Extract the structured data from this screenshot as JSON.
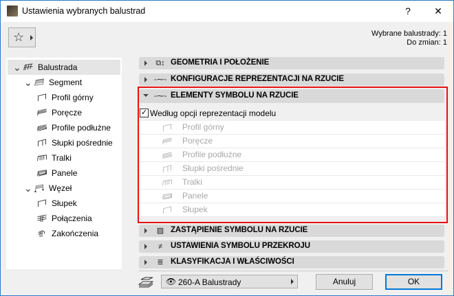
{
  "window": {
    "title": "Ustawienia wybranych balustrad",
    "help_label": "?",
    "close_label": "✕"
  },
  "counts": {
    "selected": "Wybrane balustrady: 1",
    "to_change": "Do zmian: 1"
  },
  "tree": [
    {
      "label": "Balustrada",
      "level": 0,
      "icon": "railing-icon",
      "expanded": true,
      "selected": true
    },
    {
      "label": "Segment",
      "level": 1,
      "icon": "segment-icon",
      "expanded": true
    },
    {
      "label": "Profil górny",
      "level": 2,
      "icon": "top-rail-icon"
    },
    {
      "label": "Poręcze",
      "level": 2,
      "icon": "handrail-icon"
    },
    {
      "label": "Profile podłużne",
      "level": 2,
      "icon": "rail-icon"
    },
    {
      "label": "Słupki pośrednie",
      "level": 2,
      "icon": "inner-post-icon"
    },
    {
      "label": "Tralki",
      "level": 2,
      "icon": "baluster-icon"
    },
    {
      "label": "Panele",
      "level": 2,
      "icon": "panel-icon"
    },
    {
      "label": "Węzeł",
      "level": 1,
      "icon": "node-icon",
      "expanded": true
    },
    {
      "label": "Słupek",
      "level": 2,
      "icon": "post-icon"
    },
    {
      "label": "Połączenia",
      "level": 2,
      "icon": "connection-icon"
    },
    {
      "label": "Zakończenia",
      "level": 2,
      "icon": "end-icon"
    }
  ],
  "sections": [
    {
      "label": "GEOMETRIA I POŁOŻENIE",
      "icon": "geometry-icon",
      "expanded": false
    },
    {
      "label": "KONFIGURACJE REPREZENTACJI NA RZUCIE",
      "icon": "floorplan-config-icon",
      "expanded": false
    },
    {
      "label": "ELEMENTY SYMBOLU NA RZUCIE",
      "icon": "floorplan-symbol-icon",
      "expanded": true
    },
    {
      "label": "ZASTĄPIENIE SYMBOLU NA RZUCIE",
      "icon": "symbol-override-icon",
      "expanded": false
    },
    {
      "label": "USTAWIENIA SYMBOLU PRZEKROJU",
      "icon": "section-symbol-icon",
      "expanded": false
    },
    {
      "label": "KLASYFIKACJA I WŁAŚCIWOŚCI",
      "icon": "classification-icon",
      "expanded": false
    }
  ],
  "model_option": {
    "label": "Według opcji reprezentacji modelu",
    "checked": true
  },
  "symbol_elements": [
    "Profil górny",
    "Poręcze",
    "Profile podłużne",
    "Słupki pośrednie",
    "Tralki",
    "Panele",
    "Słupek"
  ],
  "footer": {
    "layer": "260-A Balustrady",
    "cancel_label": "Anuluj",
    "ok_label": "OK"
  },
  "colors": {
    "highlight": "#e81010",
    "accent": "#0078d7"
  }
}
